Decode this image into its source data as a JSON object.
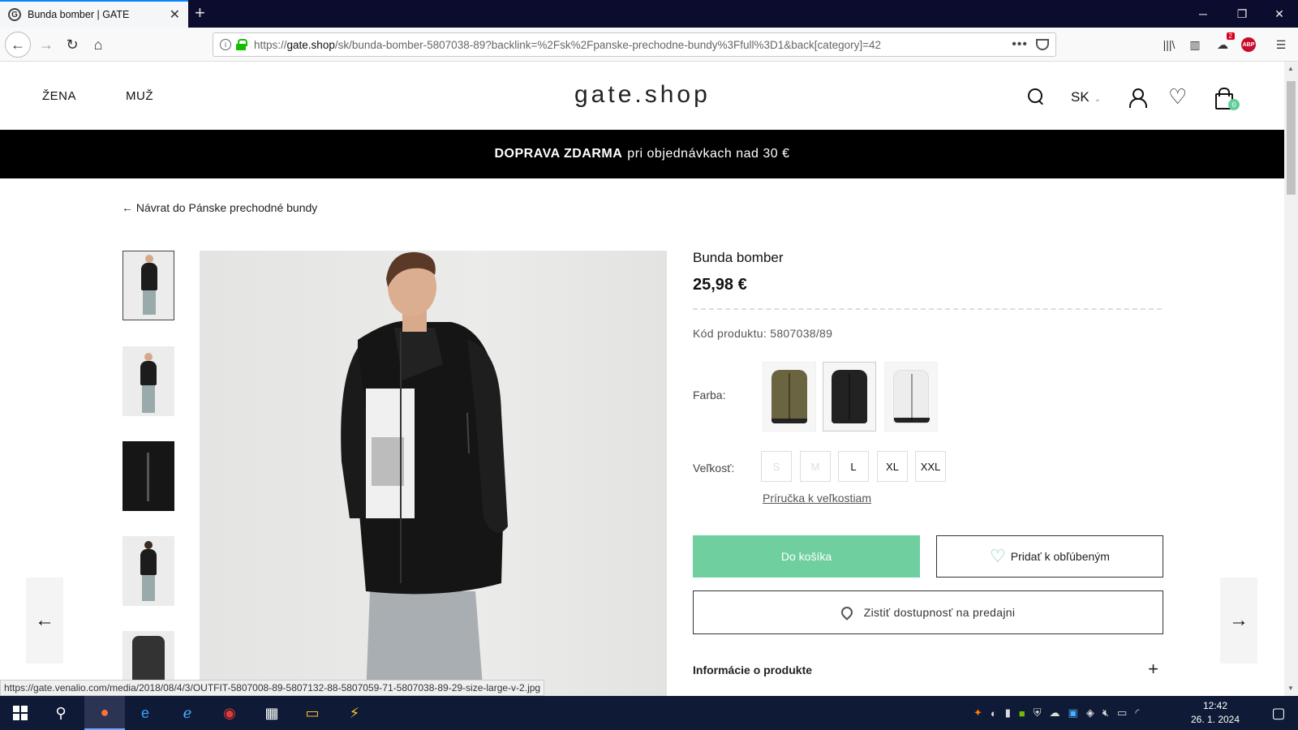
{
  "browser": {
    "tab_title": "Bunda bomber | GATE",
    "url_prefix": "https://",
    "url_domain": "gate.shop",
    "url_path": "/sk/bunda-bomber-5807038-89?backlink=%2Fsk%2Fpanske-prechodne-bundy%3Ffull%3D1&back[category]=42",
    "notif_count": "2",
    "abp_label": "ABP"
  },
  "header": {
    "nav": [
      "ŽENA",
      "MUŽ"
    ],
    "logo": "gate.shop",
    "lang": "SK",
    "cart_count": "0"
  },
  "promo": {
    "bold": "DOPRAVA ZDARMA",
    "text": "pri objednávkach nad 30 €"
  },
  "back_link": "← Návrat do Pánske prechodné bundy",
  "product": {
    "title": "Bunda bomber",
    "price": "25,98 €",
    "code": "Kód produktu: 5807038/89",
    "color_label": "Farba:",
    "colors": [
      {
        "name": "khaki",
        "hex": "#6b6440"
      },
      {
        "name": "black",
        "hex": "#222222"
      },
      {
        "name": "white",
        "hex": "#ededed"
      }
    ],
    "size_label": "Veľkosť:",
    "sizes": [
      {
        "label": "S",
        "available": false
      },
      {
        "label": "M",
        "available": false
      },
      {
        "label": "L",
        "available": true
      },
      {
        "label": "XL",
        "available": true
      },
      {
        "label": "XXL",
        "available": true
      }
    ],
    "size_guide": "Príručka k veľkostiam",
    "add_to_cart": "Do košíka",
    "add_to_fav": "Pridať k obľúbeným",
    "store_availability": "Zistiť dostupnosť na predajni",
    "info_section": "Informácie o produkte"
  },
  "accent_color": "#6fcf9e",
  "status_url": "https://gate.venalio.com/media/2018/08/4/3/OUTFIT-5807008-89-5807132-88-5807059-71-5807038-89-29-size-large-v-2.jpg",
  "taskbar": {
    "time": "12:42",
    "date": "26. 1. 2024"
  }
}
